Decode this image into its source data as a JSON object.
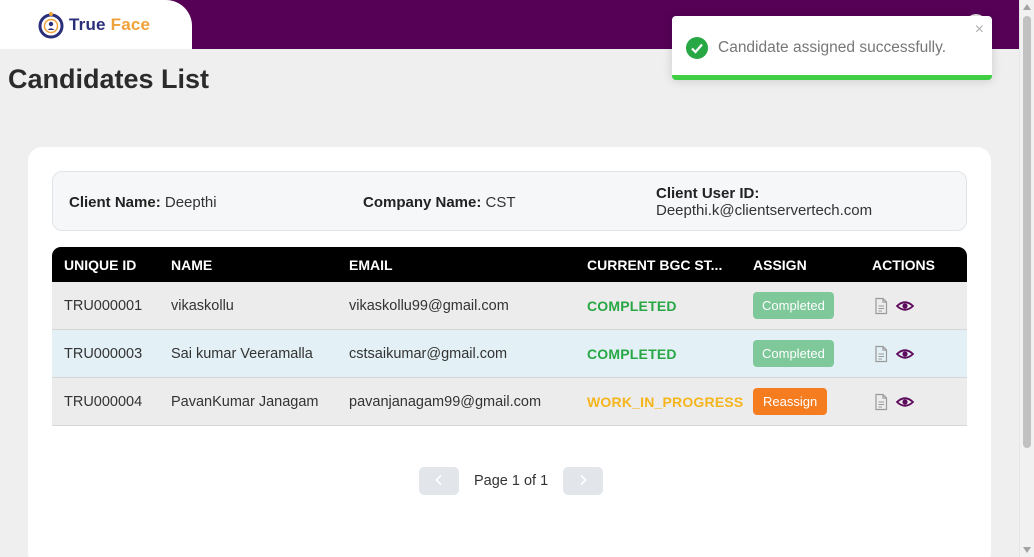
{
  "brand": {
    "name_part1": "True",
    "name_part2": "Face"
  },
  "page_title": "Candidates List",
  "client_info": {
    "client_name_label": "Client Name:",
    "client_name": "Deepthi",
    "company_name_label": "Company Name:",
    "company_name": "CST",
    "client_user_id_label": "Client User ID:",
    "client_user_id": "Deepthi.k@clientservertech.com"
  },
  "table": {
    "headers": [
      "UNIQUE ID",
      "NAME",
      "EMAIL",
      "CURRENT BGC ST...",
      "ASSIGN",
      "ACTIONS"
    ],
    "rows": [
      {
        "id": "TRU000001",
        "name": "vikaskollu",
        "email": "vikaskollu99@gmail.com",
        "status": "COMPLETED",
        "assign": "Completed"
      },
      {
        "id": "TRU000003",
        "name": "Sai kumar Veeramalla",
        "email": "cstsaikumar@gmail.com",
        "status": "COMPLETED",
        "assign": "Completed"
      },
      {
        "id": "TRU000004",
        "name": "PavanKumar Janagam",
        "email": "pavanjanagam99@gmail.com",
        "status": "WORK_IN_PROGRESS",
        "assign": "Reassign"
      }
    ]
  },
  "pagination": {
    "text": "Page 1 of 1",
    "prev_icon": "chevron-left-icon",
    "next_icon": "chevron-right-icon"
  },
  "toast": {
    "message": "Candidate assigned successfully.",
    "close": "×",
    "icon": "check-circle-icon"
  },
  "colors": {
    "topbar": "#560156",
    "status_completed": "#28a745",
    "status_progress": "#f5b51b",
    "btn_completed": "#7ec89a",
    "btn_reassign": "#f57c1f",
    "toast_progress": "#3fce44",
    "action_icon": "#5c0a5c"
  }
}
